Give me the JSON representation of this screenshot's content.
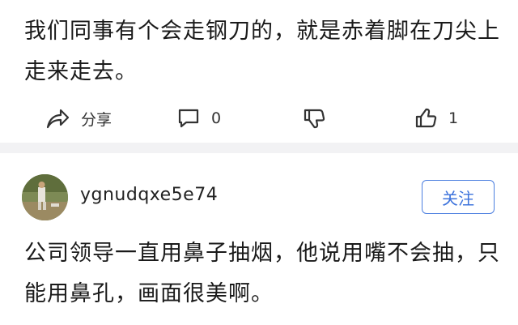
{
  "post1": {
    "text": "我们同事有个会走钢刀的，就是赤着脚在刀尖上走来走去。"
  },
  "actions": {
    "share_label": "分享",
    "comment_count": "0",
    "like_count": "1"
  },
  "post2": {
    "username": "ygnudqxe5e74",
    "follow_label": "关注",
    "text": "公司领导一直用鼻子抽烟，他说用嘴不会抽，只能用鼻孔，画面很美啊。"
  },
  "icons": {
    "share": "share-arrow-icon",
    "comment": "comment-bubble-icon",
    "dislike": "thumbs-down-icon",
    "like": "thumbs-up-icon"
  },
  "colors": {
    "follow_accent": "#4c7fe0",
    "separator": "#f2f2f4",
    "text": "#1a1a1a"
  }
}
